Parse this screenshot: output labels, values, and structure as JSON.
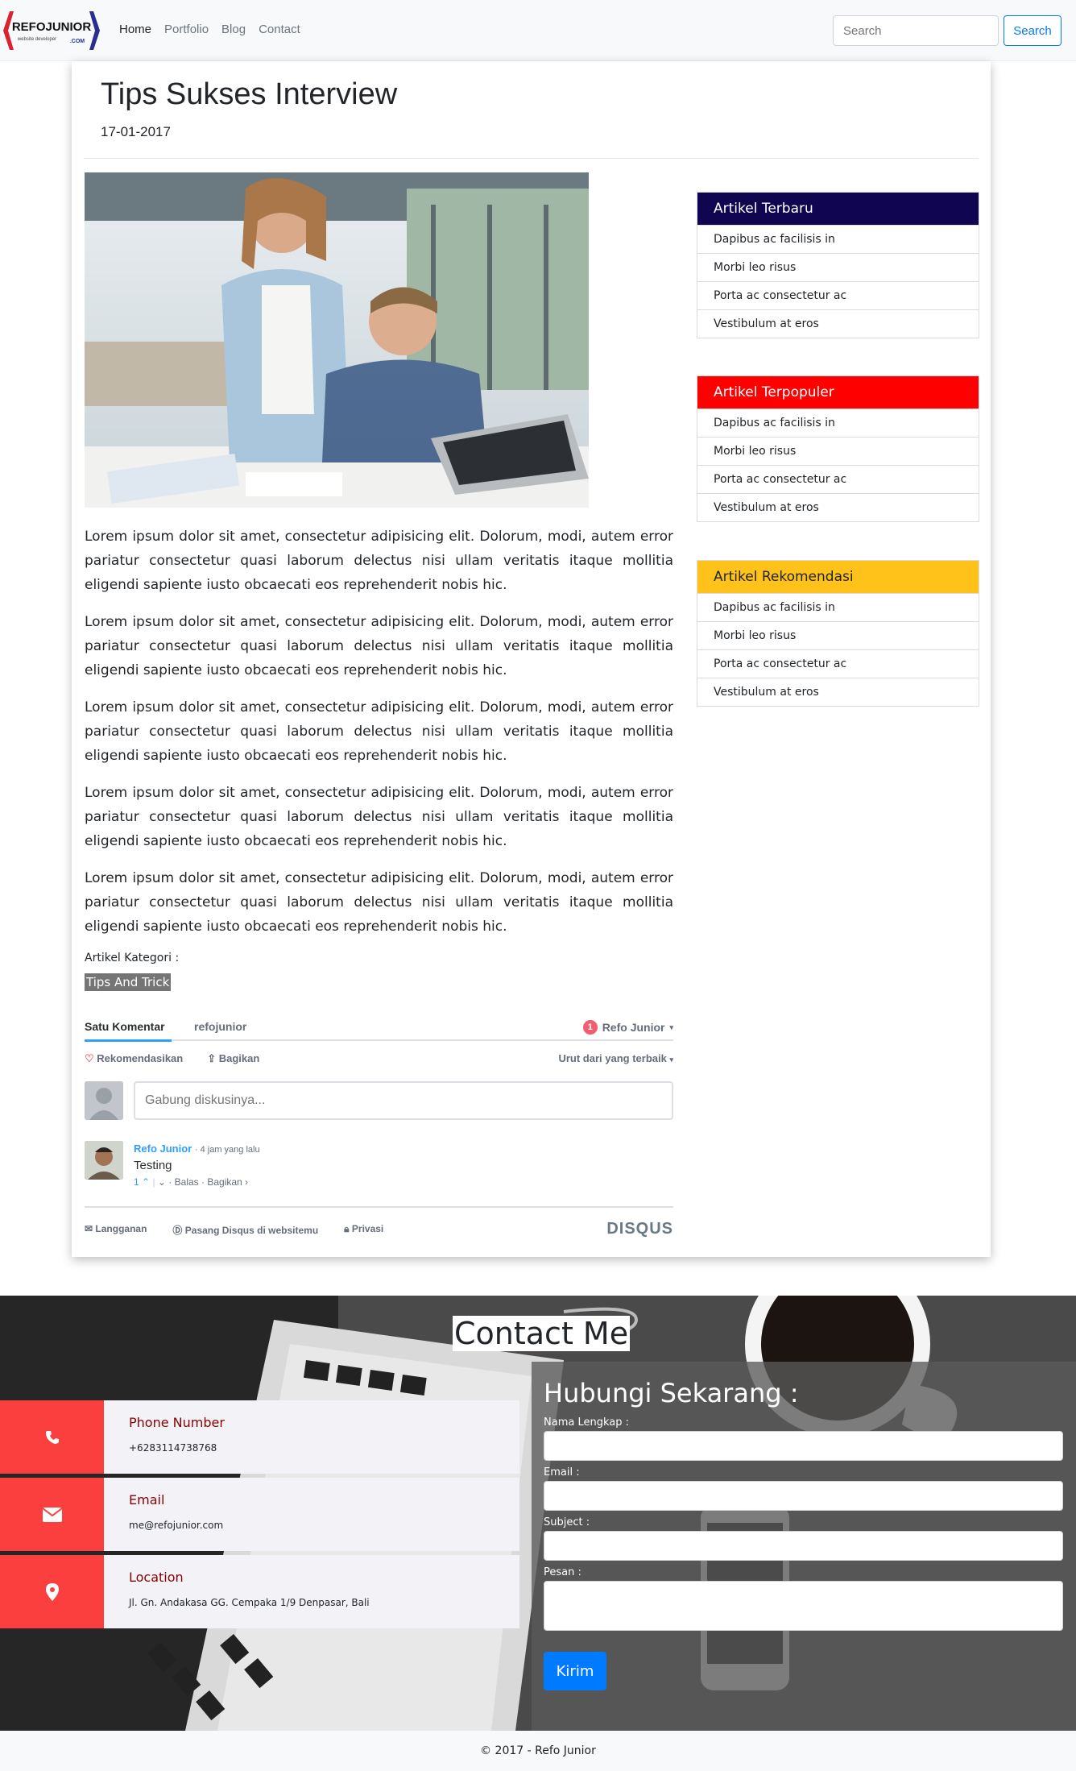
{
  "navbar": {
    "logo_text": "REFOJUNIOR",
    "logo_sub": "website developer",
    "logo_domain": ".COM",
    "links": [
      "Home",
      "Portfolio",
      "Blog",
      "Contact"
    ],
    "search_placeholder": "Search",
    "search_button": "Search"
  },
  "post": {
    "title": "Tips Sukses Interview",
    "date": "17-01-2017",
    "paragraphs": [
      "Lorem ipsum dolor sit amet, consectetur adipisicing elit. Dolorum, modi, autem error pariatur consectetur quasi laborum delectus nisi ullam veritatis itaque mollitia eligendi sapiente iusto obcaecati eos reprehenderit nobis hic.",
      "Lorem ipsum dolor sit amet, consectetur adipisicing elit. Dolorum, modi, autem error pariatur consectetur quasi laborum delectus nisi ullam veritatis itaque mollitia eligendi sapiente iusto obcaecati eos reprehenderit nobis hic.",
      "Lorem ipsum dolor sit amet, consectetur adipisicing elit. Dolorum, modi, autem error pariatur consectetur quasi laborum delectus nisi ullam veritatis itaque mollitia eligendi sapiente iusto obcaecati eos reprehenderit nobis hic.",
      "Lorem ipsum dolor sit amet, consectetur adipisicing elit. Dolorum, modi, autem error pariatur consectetur quasi laborum delectus nisi ullam veritatis itaque mollitia eligendi sapiente iusto obcaecati eos reprehenderit nobis hic.",
      "Lorem ipsum dolor sit amet, consectetur adipisicing elit. Dolorum, modi, autem error pariatur consectetur quasi laborum delectus nisi ullam veritatis itaque mollitia eligendi sapiente iusto obcaecati eos reprehenderit nobis hic."
    ],
    "kategori_label": "Artikel Kategori :",
    "tag": "Tips And Trick"
  },
  "disqus": {
    "tab_comments": "Satu Komentar",
    "tab_site": "refojunior",
    "user_badge": "1",
    "user_name": "Refo Junior",
    "recommend": "Rekomendasikan",
    "share": "Bagikan",
    "sort": "Urut dari yang terbaik",
    "input_placeholder": "Gabung diskusinya...",
    "comment_author": "Refo Junior",
    "comment_meta": "· 4 jam yang lalu",
    "comment_text": "Testing",
    "comment_votes": "1",
    "comment_reply": "Balas",
    "comment_share": "Bagikan ›",
    "footer_subscribe": "Langganan",
    "footer_install": "Pasang Disqus di websitemu",
    "footer_privacy": "Privasi",
    "brand": "DISQUS"
  },
  "sidebar": [
    {
      "heading": "Artikel Terbaru",
      "color": "#0f0550",
      "text_color": "#ffffff",
      "items": [
        "Dapibus ac facilisis in",
        "Morbi leo risus",
        "Porta ac consectetur ac",
        "Vestibulum at eros"
      ]
    },
    {
      "heading": "Artikel Terpopuler",
      "color": "#ff0000",
      "text_color": "#ffffff",
      "items": [
        "Dapibus ac facilisis in",
        "Morbi leo risus",
        "Porta ac consectetur ac",
        "Vestibulum at eros"
      ]
    },
    {
      "heading": "Artikel Rekomendasi",
      "color": "#ffc21a",
      "text_color": "#212529",
      "items": [
        "Dapibus ac facilisis in",
        "Morbi leo risus",
        "Porta ac consectetur ac",
        "Vestibulum at eros"
      ]
    }
  ],
  "contact": {
    "title": "Contact Me",
    "info": [
      {
        "label": "Phone Number",
        "value": "+6283114738768",
        "icon": "phone-icon"
      },
      {
        "label": "Email",
        "value": "me@refojunior.com",
        "icon": "envelope-icon"
      },
      {
        "label": "Location",
        "value": "Jl. Gn. Andakasa GG. Cempaka 1/9 Denpasar, Bali",
        "icon": "map-marker-icon"
      }
    ],
    "form_title": "Hubungi Sekarang :",
    "fields": [
      "Nama Lengkap :",
      "Email :",
      "Subject :",
      "Pesan :"
    ],
    "submit": "Kirim"
  },
  "footer": {
    "text": "© 2017 - Refo Junior"
  },
  "colors": {
    "accent": "#007bff",
    "contact_red": "#fb3e3e",
    "label_red": "#8b0000"
  }
}
